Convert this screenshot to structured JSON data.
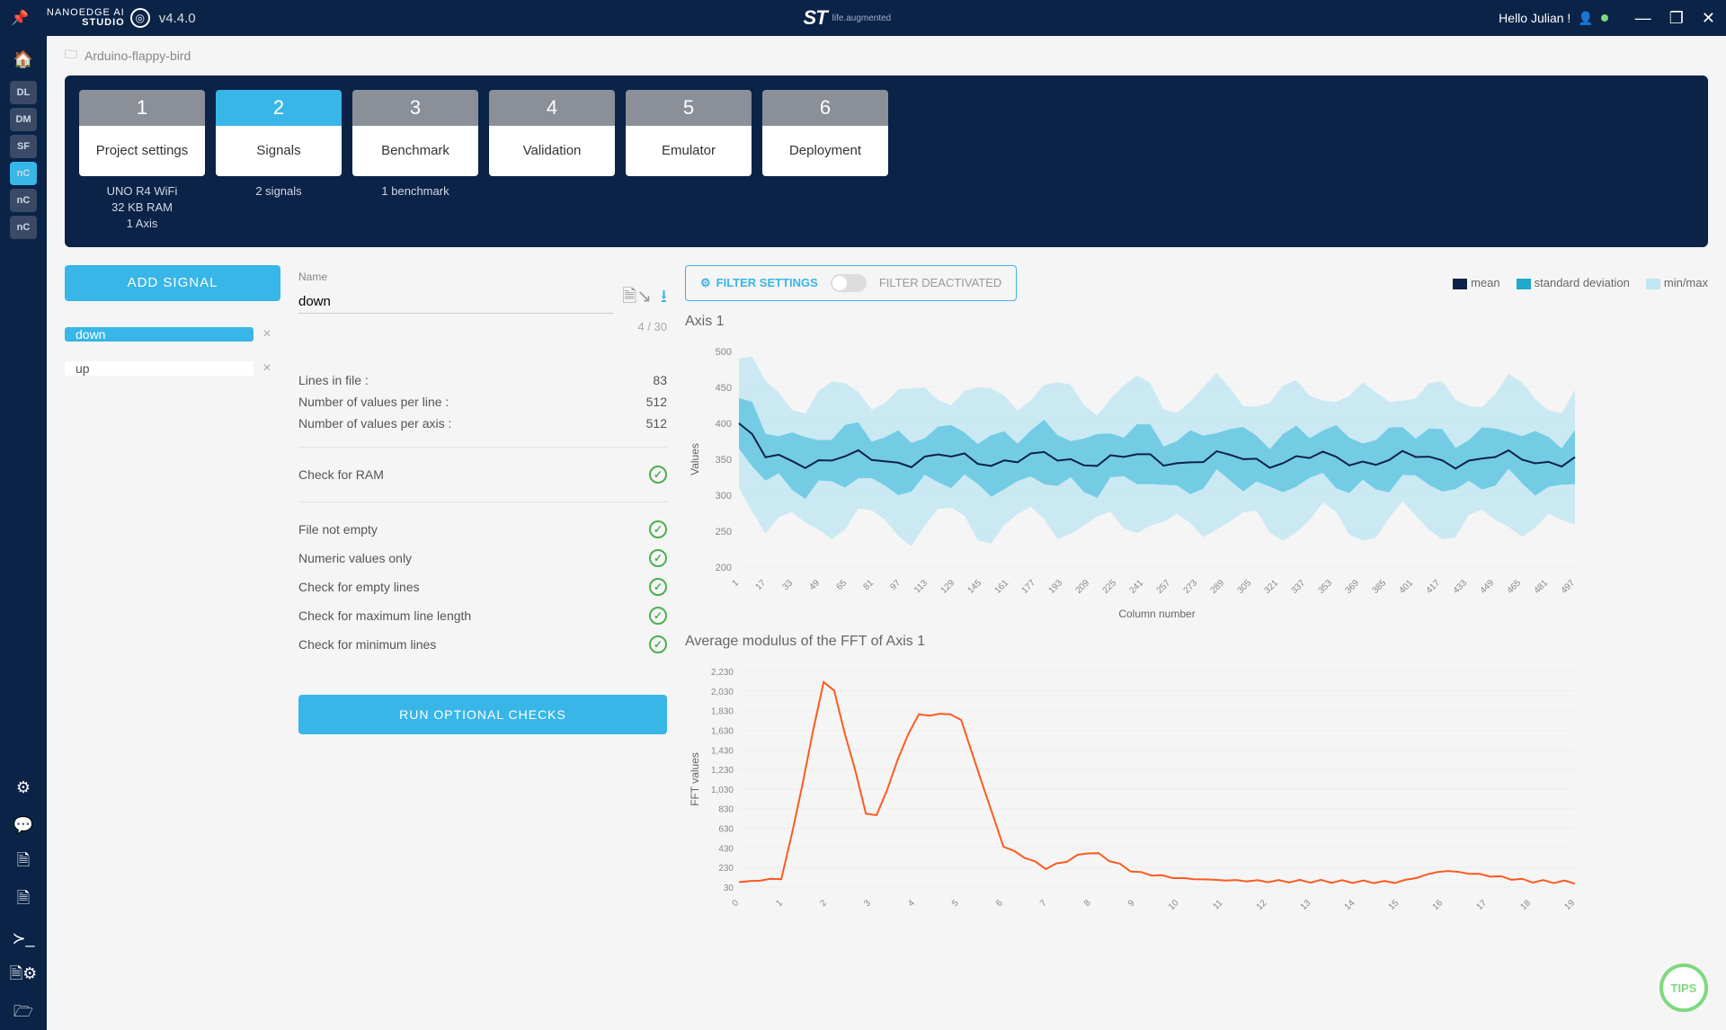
{
  "topbar": {
    "logo_line1": "NANOEDGE AI",
    "logo_line2": "STUDIO",
    "version": "v4.4.0",
    "st_logo": "ST",
    "st_sub": "life.augmented",
    "greeting": "Hello Julian !"
  },
  "sidebar": {
    "tiles": [
      "DL",
      "DM",
      "SF",
      "nC",
      "nC",
      "nC"
    ],
    "active": 3
  },
  "breadcrumb": "Arduino-flappy-bird",
  "steps": [
    {
      "num": "1",
      "label": "Project settings",
      "sub": "UNO R4 WiFi\n32 KB RAM\n1 Axis",
      "active": false
    },
    {
      "num": "2",
      "label": "Signals",
      "sub": "2 signals",
      "active": true
    },
    {
      "num": "3",
      "label": "Benchmark",
      "sub": "1 benchmark",
      "active": false
    },
    {
      "num": "4",
      "label": "Validation",
      "sub": "",
      "active": false
    },
    {
      "num": "5",
      "label": "Emulator",
      "sub": "",
      "active": false
    },
    {
      "num": "6",
      "label": "Deployment",
      "sub": "",
      "active": false
    }
  ],
  "add_signal": "ADD SIGNAL",
  "signals": [
    {
      "name": "down",
      "active": true
    },
    {
      "name": "up",
      "active": false
    }
  ],
  "name_field": {
    "label": "Name",
    "value": "down",
    "counter": "4 / 30"
  },
  "info": [
    {
      "label": "Lines in file :",
      "value": "83"
    },
    {
      "label": "Number of values per line :",
      "value": "512"
    },
    {
      "label": "Number of values per axis :",
      "value": "512"
    }
  ],
  "check_ram": "Check for RAM",
  "checks": [
    "File not empty",
    "Numeric values only",
    "Check for empty lines",
    "Check for maximum line length",
    "Check for minimum lines"
  ],
  "run_optional": "RUN OPTIONAL CHECKS",
  "filter": {
    "label": "FILTER SETTINGS",
    "status": "FILTER DEACTIVATED"
  },
  "legend": {
    "mean": "mean",
    "std": "standard deviation",
    "mm": "min/max"
  },
  "chart1": {
    "title": "Axis 1",
    "ylabel": "Values",
    "xlabel": "Column number"
  },
  "chart2": {
    "title": "Average modulus of the FFT of Axis 1",
    "ylabel": "FFT values"
  },
  "tips": "TIPS",
  "chart_data": [
    {
      "type": "line",
      "title": "Axis 1",
      "xlabel": "Column number",
      "ylabel": "Values",
      "x_ticks": [
        1,
        17,
        33,
        49,
        65,
        81,
        97,
        113,
        129,
        145,
        161,
        177,
        193,
        209,
        225,
        241,
        257,
        273,
        289,
        305,
        321,
        337,
        353,
        369,
        385,
        401,
        417,
        433,
        449,
        465,
        481,
        497
      ],
      "ylim": [
        200,
        500
      ],
      "y_ticks": [
        200,
        250,
        300,
        350,
        400,
        450,
        500
      ],
      "series": [
        {
          "name": "mean",
          "approx": "oscillates around 350, starts near 400 at column 1, dips to ~320 around column 20, stabilises between 340-360 across remaining columns"
        },
        {
          "name": "standard deviation",
          "approx": "band roughly 310-390 around the mean"
        },
        {
          "name": "min/max",
          "approx": "band roughly 250-460 around the mean"
        }
      ]
    },
    {
      "type": "line",
      "title": "Average modulus of the FFT of Axis 1",
      "ylabel": "FFT values",
      "x_range": [
        0,
        20
      ],
      "x_ticks": [
        0,
        1,
        2,
        3,
        4,
        5,
        6,
        7,
        8,
        9,
        10,
        11,
        12,
        13,
        14,
        15,
        16,
        17,
        18,
        19
      ],
      "ylim": [
        30,
        2230
      ],
      "y_ticks": [
        30,
        230,
        430,
        630,
        830,
        1030,
        1230,
        1430,
        1630,
        1830,
        2030,
        2230
      ],
      "series": [
        {
          "name": "FFT",
          "values_approx": [
            80,
            120,
            2300,
            600,
            1780,
            1800,
            450,
            220,
            400,
            180,
            120,
            100,
            90,
            90,
            85,
            80,
            200,
            150,
            90,
            80
          ]
        }
      ]
    }
  ]
}
